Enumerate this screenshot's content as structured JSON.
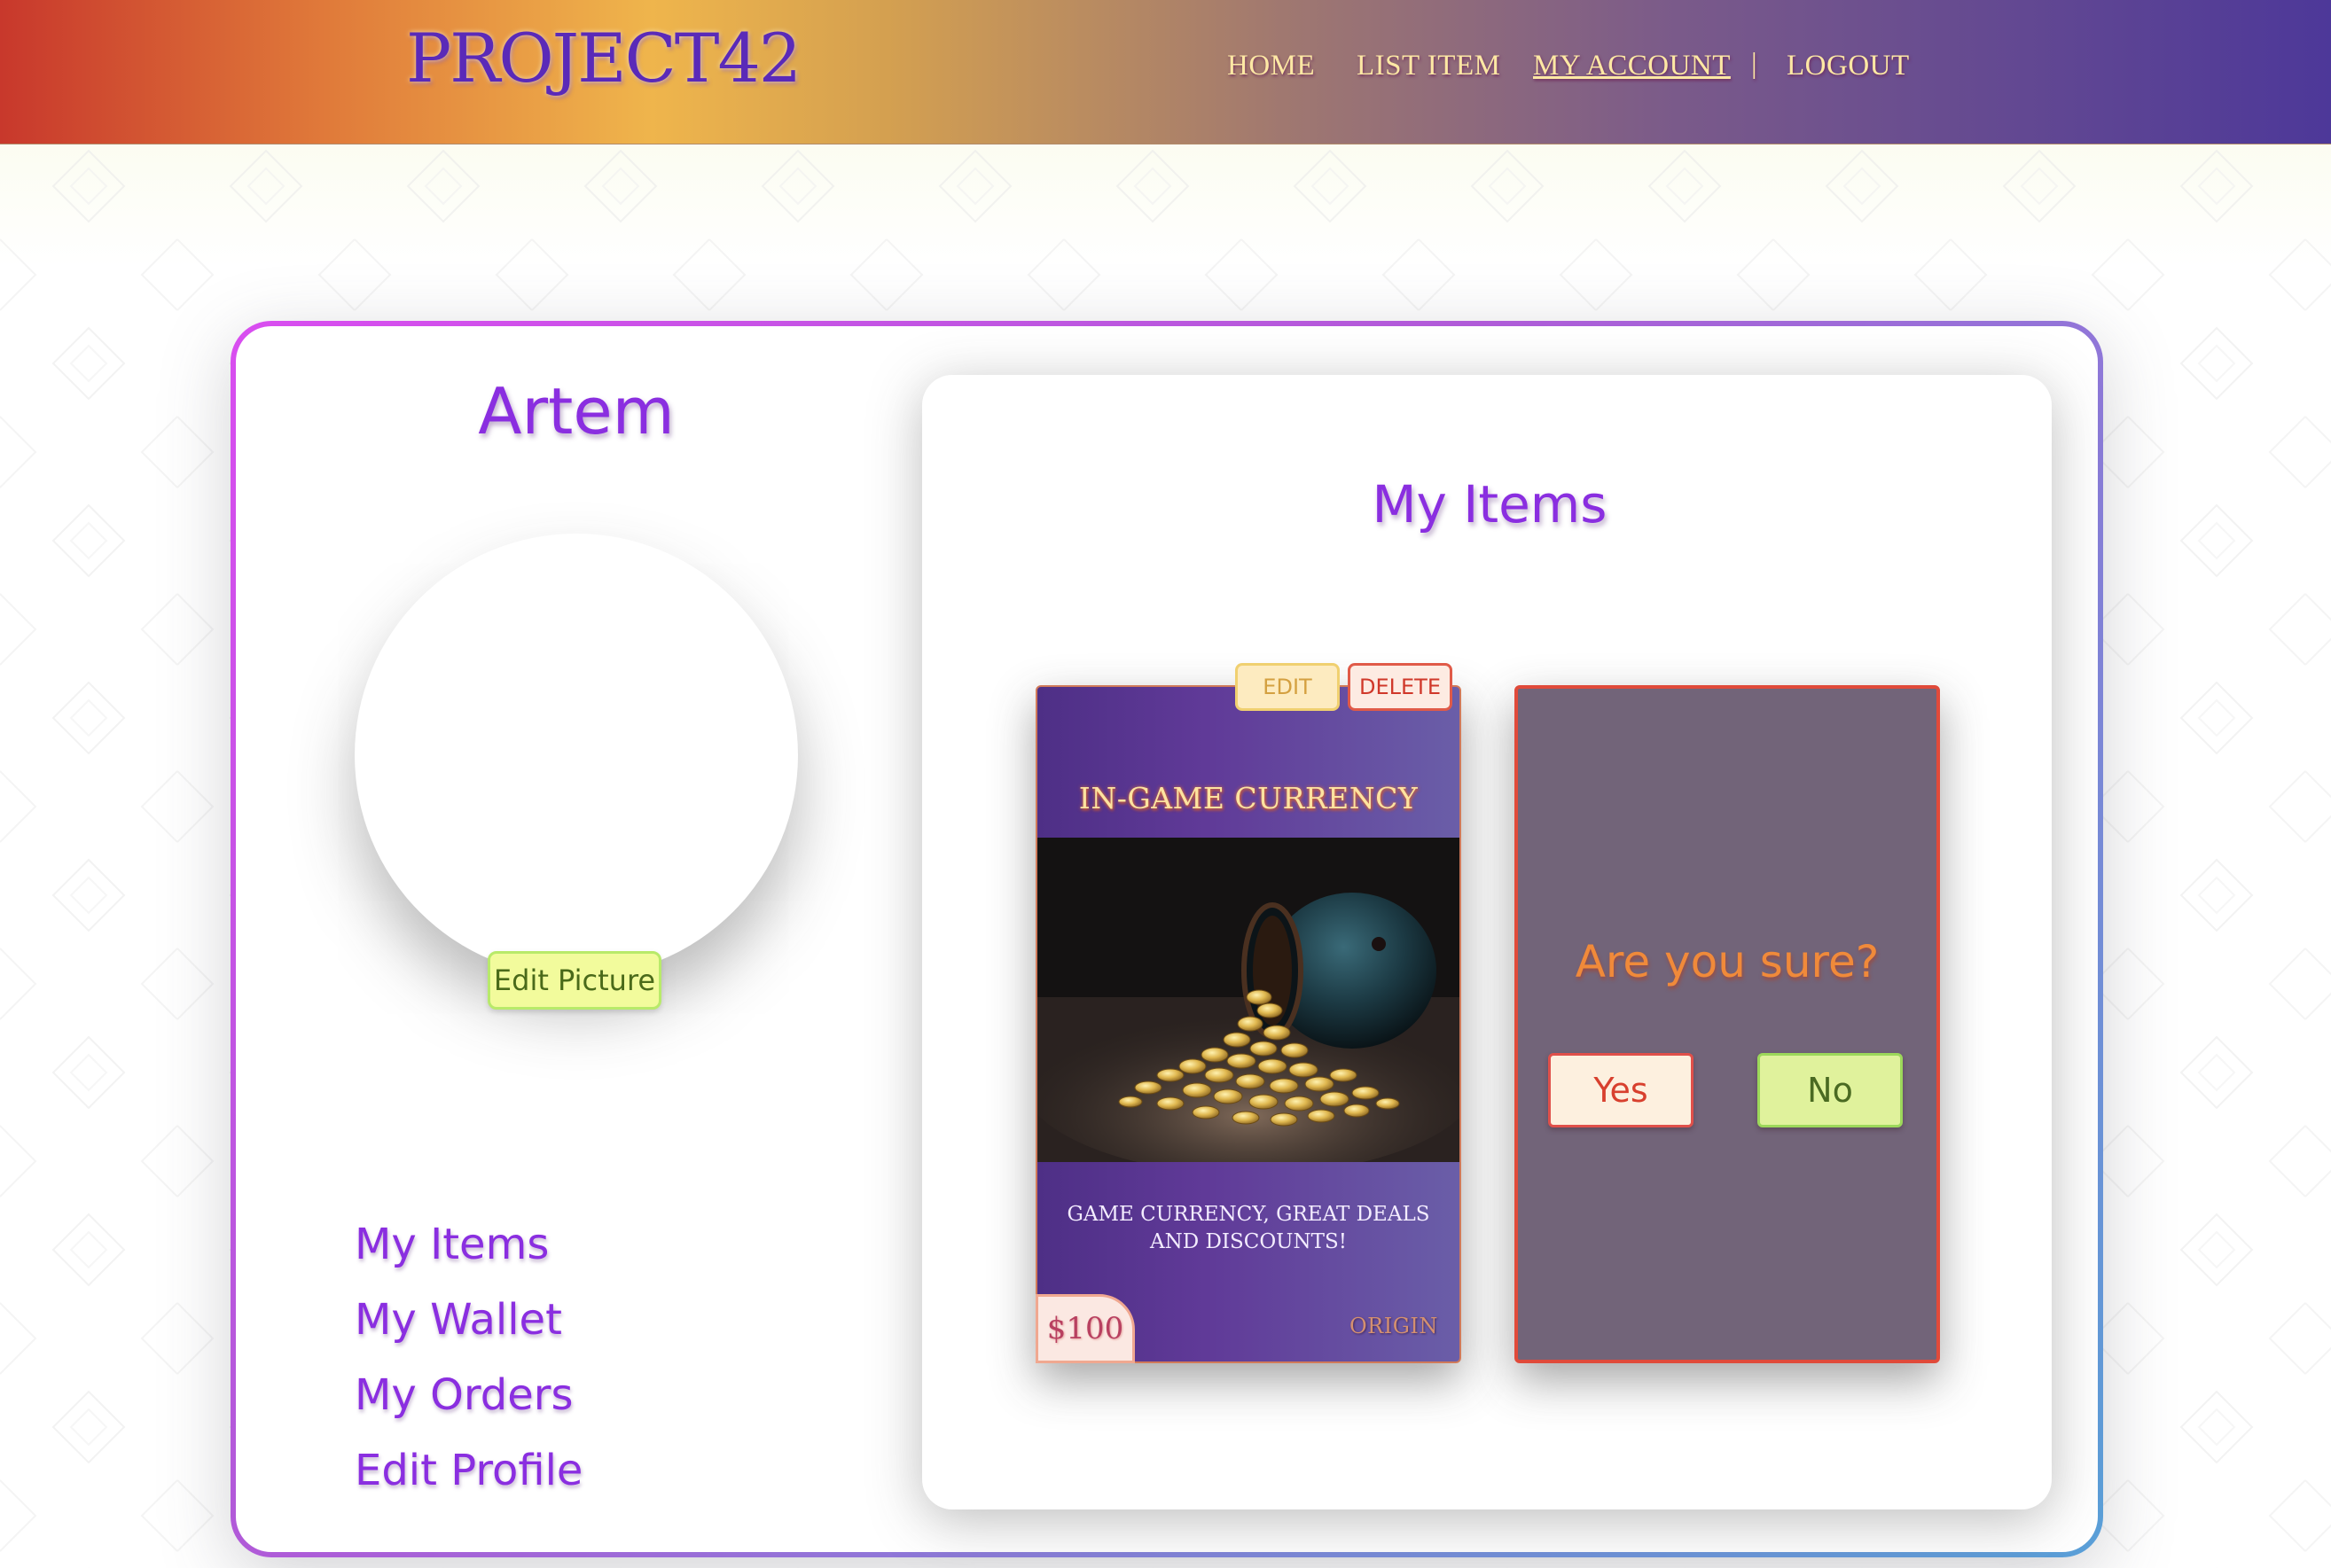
{
  "header": {
    "logo": "PROJECT42",
    "nav": {
      "home": "HOME",
      "list_item": "LIST ITEM",
      "my_account": "MY ACCOUNT",
      "separator": "|",
      "logout": "LOGOUT"
    }
  },
  "profile": {
    "username": "Artem",
    "edit_picture_label": "Edit Picture",
    "side_links": {
      "my_items": "My Items",
      "my_wallet": "My Wallet",
      "my_orders": "My Orders",
      "edit_profile": "Edit Profile"
    }
  },
  "items_panel": {
    "title": "My Items",
    "item": {
      "title": "IN-GAME CURRENCY",
      "description": "GAME CURRENCY, GREAT DEALS AND DISCOUNTS!",
      "price": "$100",
      "origin": "ORIGIN",
      "edit_label": "EDIT",
      "delete_label": "DELETE",
      "image_icon": "pot-of-gold-coins-image"
    },
    "confirm": {
      "question": "Are you sure?",
      "yes_label": "Yes",
      "no_label": "No"
    }
  },
  "colors": {
    "accent_purple": "#8a2ee0",
    "header_gradient_start": "#c8382c",
    "header_gradient_mid": "#efb54c",
    "header_gradient_end": "#4d3899",
    "confirm_bg": "#726479",
    "danger_red": "#e04a3a",
    "success_green": "#9cd85a"
  }
}
